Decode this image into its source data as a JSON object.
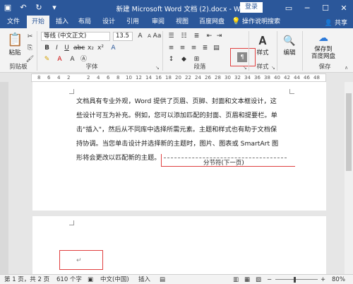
{
  "title_bar": {
    "document_title": "新建 Microsoft Word 文档 (2).docx - Word",
    "login_label": "登录"
  },
  "tabs": [
    {
      "label": "文件"
    },
    {
      "label": "开始"
    },
    {
      "label": "插入"
    },
    {
      "label": "布局"
    },
    {
      "label": "设计"
    },
    {
      "label": "引用"
    },
    {
      "label": "审阅"
    },
    {
      "label": "视图"
    },
    {
      "label": "百度网盘"
    },
    {
      "label": "操作说明搜索"
    }
  ],
  "share_label": "共享",
  "ribbon": {
    "clipboard": {
      "paste_label": "粘贴",
      "group_label": "剪贴板"
    },
    "font": {
      "font_name": "等线 (中文正文)",
      "font_size": "13.5",
      "group_label": "字体"
    },
    "paragraph": {
      "group_label": "段落"
    },
    "styles": {
      "style_label": "样式",
      "group_label": "样式"
    },
    "editing": {
      "edit_label": "编辑"
    },
    "save": {
      "save_label": "保存到\n百度网盘",
      "group_label": "保存"
    }
  },
  "ruler_ticks": [
    "8",
    "6",
    "4",
    "2",
    "",
    "2",
    "4",
    "6",
    "8",
    "10",
    "12",
    "14",
    "16",
    "18",
    "20",
    "22",
    "24",
    "26",
    "28",
    "30",
    "32",
    "34",
    "36",
    "38",
    "40",
    "42",
    "44",
    "46",
    "48"
  ],
  "document": {
    "lines": [
      "文档具有专业外观，Word 提供了页眉、页脚、封面和文本框设计，这",
      "些设计可互为补充。例如，您可以添加匹配的封面、页眉和提要栏。单",
      "击\"插入\"，然后从不同库中选择所需元素。主题和样式也有助于文档保",
      "持协调。当您单击设计并选择新的主题时，图片、图表或 SmartArt 图",
      "形将会更改以匹配新的主题。"
    ],
    "section_break_label": "分节符(下一页)",
    "paragraph_mark": "↵"
  },
  "status_bar": {
    "page_info": "第 1 页，共 2 页",
    "word_count": "610 个字",
    "language": "中文(中国)",
    "mode": "插入",
    "zoom": "80%"
  },
  "colors": {
    "accent": "#2b579a",
    "highlight": "#e04040"
  }
}
